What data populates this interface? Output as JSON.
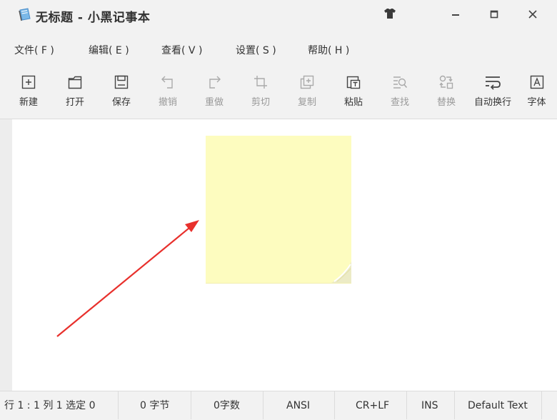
{
  "window": {
    "title": "无标题 - 小黑记事本",
    "icons": {
      "app": "notebook-icon",
      "skin": "tshirt-icon",
      "minimize": "minimize-icon",
      "maximize": "maximize-icon",
      "close": "close-icon"
    }
  },
  "menu": [
    {
      "label": "文件( F )"
    },
    {
      "label": "编辑( E )"
    },
    {
      "label": "查看( V )"
    },
    {
      "label": "设置( S )"
    },
    {
      "label": "帮助( H )"
    }
  ],
  "toolbar": [
    {
      "label": "新建",
      "icon": "new-file-icon",
      "enabled": true
    },
    {
      "label": "打开",
      "icon": "folder-icon",
      "enabled": true
    },
    {
      "label": "保存",
      "icon": "save-icon",
      "enabled": true
    },
    {
      "label": "撤销",
      "icon": "undo-icon",
      "enabled": false
    },
    {
      "label": "重做",
      "icon": "redo-icon",
      "enabled": false
    },
    {
      "label": "剪切",
      "icon": "cut-crop-icon",
      "enabled": false
    },
    {
      "label": "复制",
      "icon": "copy-icon",
      "enabled": false
    },
    {
      "label": "粘贴",
      "icon": "paste-icon",
      "enabled": true
    },
    {
      "label": "查找",
      "icon": "find-icon",
      "enabled": false
    },
    {
      "label": "替换",
      "icon": "replace-icon",
      "enabled": false
    },
    {
      "label": "自动换行",
      "icon": "word-wrap-icon",
      "enabled": true
    },
    {
      "label": "字体",
      "icon": "font-icon",
      "enabled": true
    }
  ],
  "editor": {
    "content": "",
    "sticky_note_color": "#fdfcbf",
    "arrow_color": "#e8302c"
  },
  "status": {
    "position": "行 1 : 1    列 1    选定 0",
    "bytes": "0 字节",
    "chars": "0字数",
    "encoding": "ANSI",
    "line_ending": "CR+LF",
    "insert_mode": "INS",
    "theme": "Default Text"
  }
}
